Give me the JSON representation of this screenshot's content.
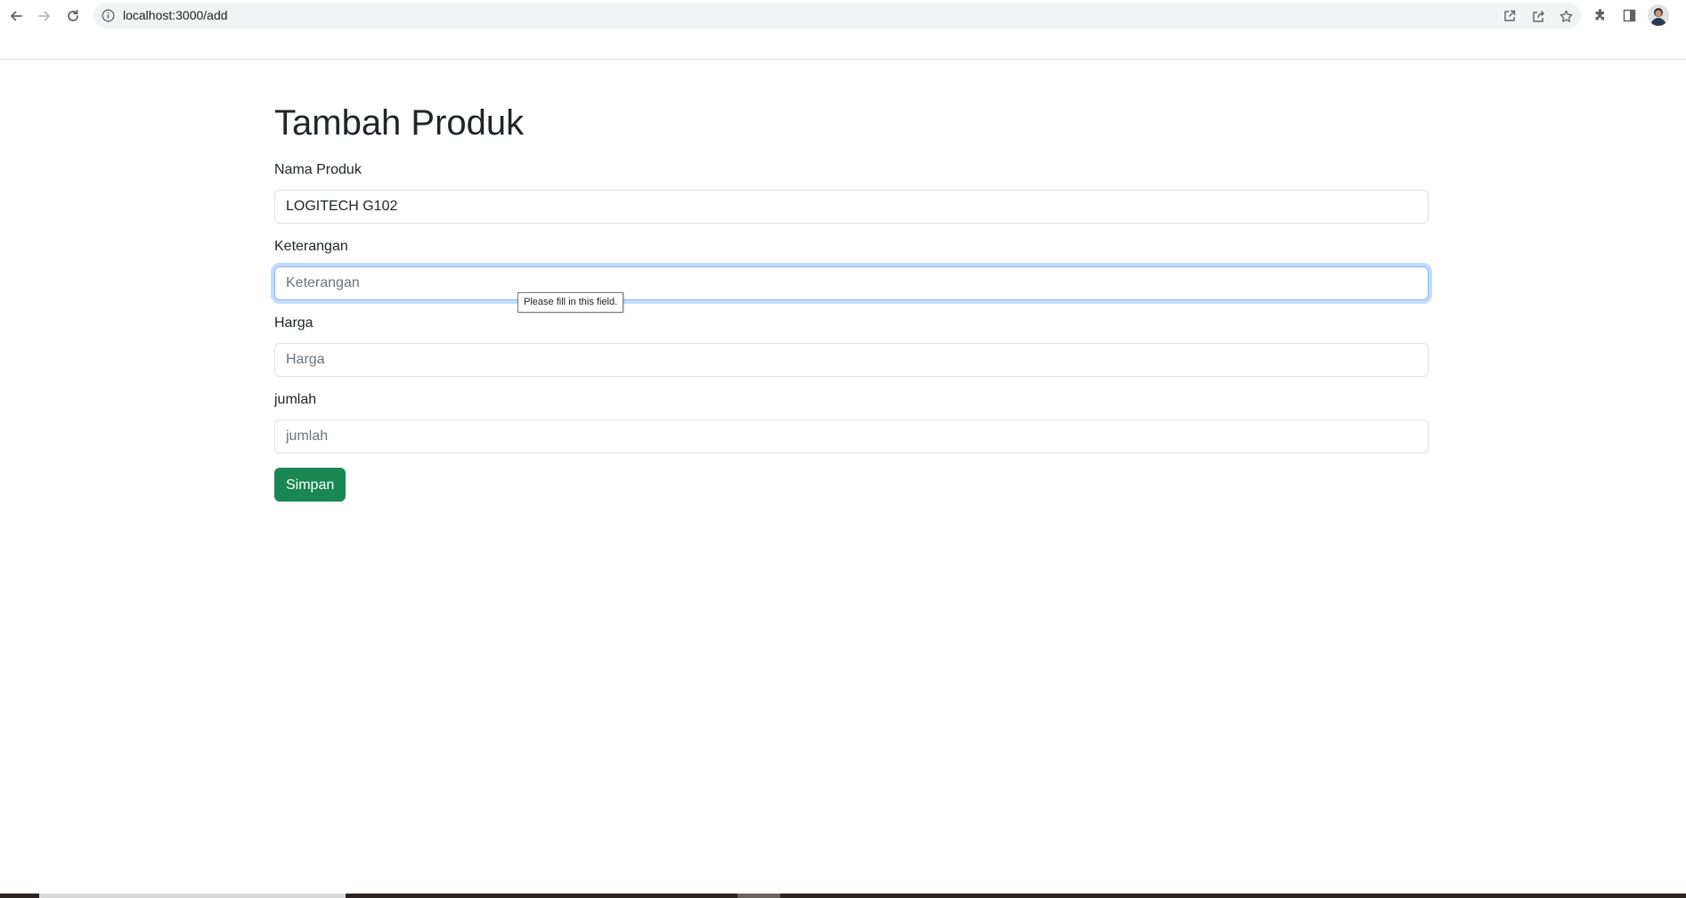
{
  "browser": {
    "url": "localhost:3000/add",
    "nav": {
      "back_icon": "arrow-left-icon",
      "forward_icon": "arrow-right-icon",
      "reload_icon": "reload-icon"
    },
    "omnibox_actions": [
      "open-in-new-icon",
      "share-icon",
      "star-icon"
    ],
    "toolbar": [
      "extensions-icon",
      "side-panel-icon",
      "profile-avatar"
    ]
  },
  "page": {
    "title": "Tambah Produk",
    "fields": [
      {
        "label": "Nama Produk",
        "value": "LOGITECH G102",
        "placeholder": "Nama Produk"
      },
      {
        "label": "Keterangan",
        "value": "",
        "placeholder": "Keterangan",
        "focused": true
      },
      {
        "label": "Harga",
        "value": "",
        "placeholder": "Harga"
      },
      {
        "label": "jumlah",
        "value": "",
        "placeholder": "jumlah"
      }
    ],
    "submit_label": "Simpan",
    "validation_tooltip": "Please fill in this field."
  },
  "colors": {
    "accent_success": "#198754",
    "focus_ring": "#86b7fe",
    "text": "#212529",
    "placeholder": "#6c757d"
  }
}
